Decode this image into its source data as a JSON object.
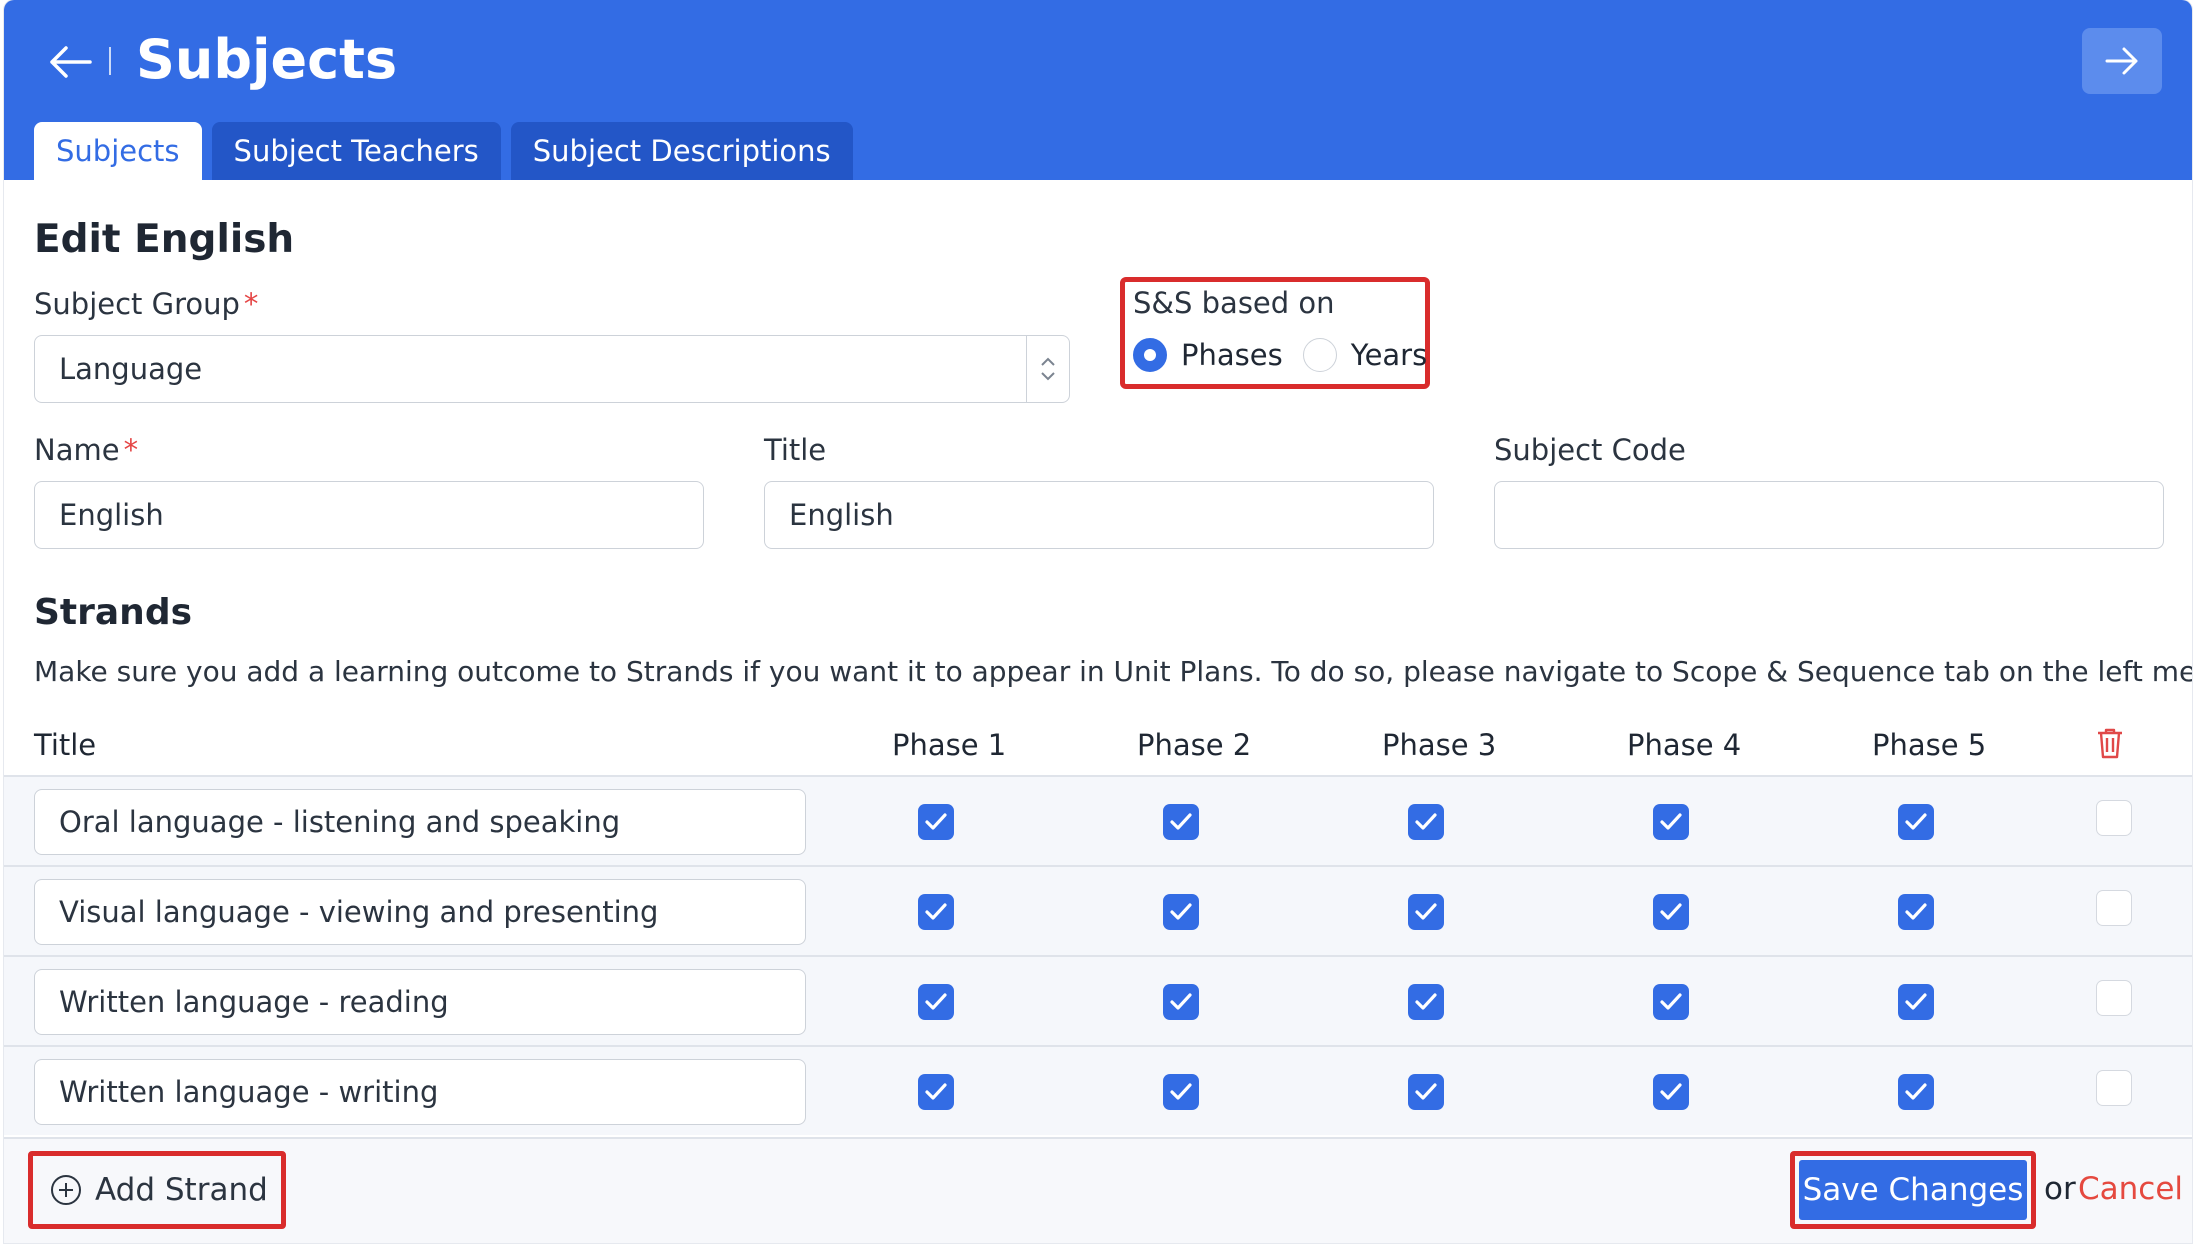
{
  "header": {
    "title": "Subjects",
    "back_icon": "arrow-left-icon",
    "forward_icon": "arrow-right-icon"
  },
  "tabs": [
    {
      "label": "Subjects",
      "active": true
    },
    {
      "label": "Subject Teachers",
      "active": false
    },
    {
      "label": "Subject Descriptions",
      "active": false
    }
  ],
  "form": {
    "heading": "Edit English",
    "subject_group": {
      "label": "Subject Group",
      "value": "Language"
    },
    "ss_based_on": {
      "label": "S&S based on",
      "options": [
        {
          "label": "Phases",
          "selected": true
        },
        {
          "label": "Years",
          "selected": false
        }
      ]
    },
    "name": {
      "label": "Name",
      "value": "English"
    },
    "title": {
      "label": "Title",
      "value": "English"
    },
    "subject_code": {
      "label": "Subject Code",
      "value": ""
    }
  },
  "strands": {
    "heading": "Strands",
    "note": "Make sure you add a learning outcome to Strands if you want it to appear in Unit Plans. To do so, please navigate to Scope & Sequence tab on the left menu.",
    "columns": [
      "Title",
      "Phase 1",
      "Phase 2",
      "Phase 3",
      "Phase 4",
      "Phase 5"
    ],
    "rows": [
      {
        "title": "Oral language - listening and speaking",
        "phases": [
          true,
          true,
          true,
          true,
          true
        ],
        "delete": false
      },
      {
        "title": "Visual language - viewing and presenting",
        "phases": [
          true,
          true,
          true,
          true,
          true
        ],
        "delete": false
      },
      {
        "title": "Written language - reading",
        "phases": [
          true,
          true,
          true,
          true,
          true
        ],
        "delete": false
      },
      {
        "title": "Written language - writing",
        "phases": [
          true,
          true,
          true,
          true,
          true
        ],
        "delete": false
      }
    ]
  },
  "footer": {
    "add_strand_label": "Add Strand",
    "save_label": "Save Changes",
    "or_text": "or",
    "cancel_label": "Cancel"
  },
  "colors": {
    "primary": "#336ce4",
    "highlight_border": "#d92c2c",
    "cancel": "#e5493f",
    "delete_icon": "#e04848"
  }
}
